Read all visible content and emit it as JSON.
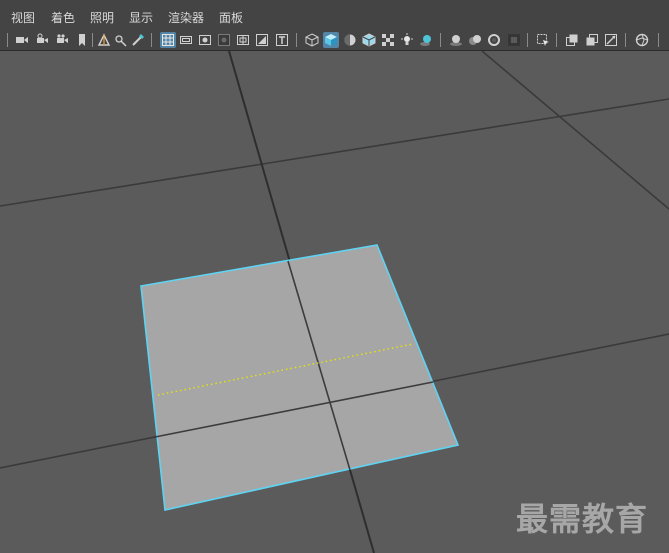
{
  "menu": {
    "items": [
      "视图",
      "着色",
      "照明",
      "显示",
      "渲染器",
      "面板"
    ]
  },
  "toolbar": {
    "icons": [
      "camera-select-icon",
      "camera-attributes-icon",
      "camera-bookmark-icon",
      "bookmark-icon",
      "image-plane-icon",
      "grease-pencil-icon",
      "2d-pan-zoom-icon",
      "grid-icon",
      "film-gate-icon",
      "resolution-gate-icon",
      "gate-mask-icon",
      "field-chart-icon",
      "safe-action-icon",
      "safe-title-icon",
      "wireframe-icon",
      "smooth-shade-all-icon",
      "use-default-material-icon",
      "wireframe-on-shaded-icon",
      "textured-icon",
      "use-all-lights-icon",
      "shadows-icon",
      "screen-space-ambient-occlusion-icon",
      "motion-blur-icon",
      "multisample-antialiasing-icon",
      "depth-of-field-icon",
      "isolate-select-icon",
      "xray-icon",
      "xray-active-components-icon",
      "xray-joints-icon",
      "exposure-icon"
    ],
    "active_icon": "smooth-shade-all-icon",
    "accent_color": "#5285a6"
  },
  "viewport": {
    "background_color": "#5b5b5b",
    "grid_color": "#3a3a3a",
    "plane_color": "#a6a6a6",
    "selection_outline_color": "#5fd3f3",
    "dotted_line_color": "#e6e600"
  },
  "watermark": {
    "text": "最需教育"
  }
}
